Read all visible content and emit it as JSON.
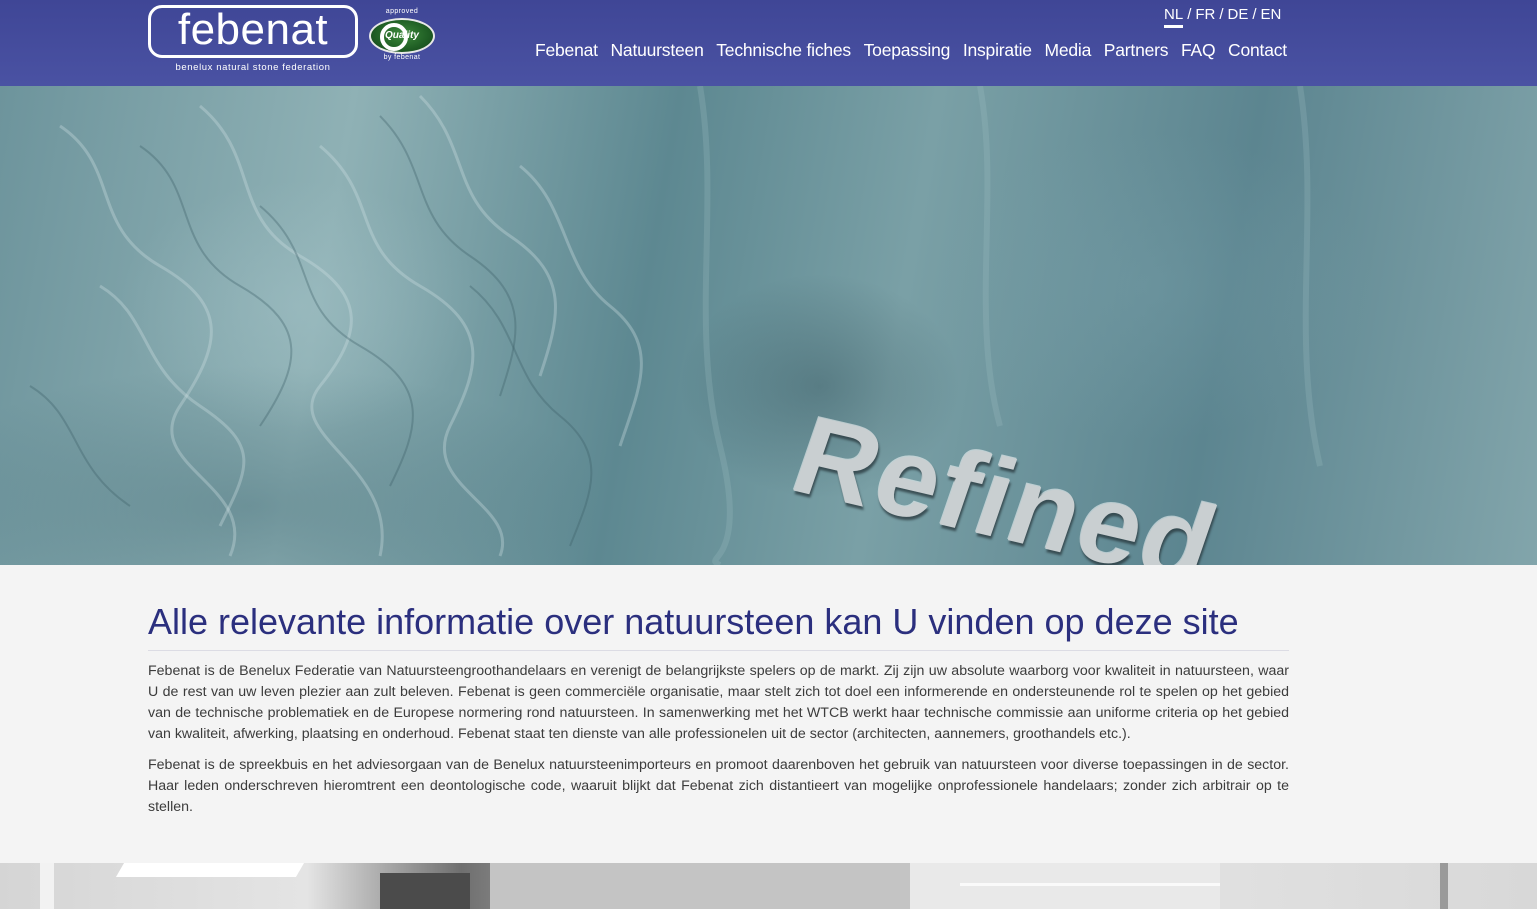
{
  "header": {
    "logo": {
      "word": "febenat",
      "tagline": "benelux natural stone federation"
    },
    "quality_badge": {
      "top": "approved",
      "word": "Quality",
      "bottom": "by febenat"
    },
    "languages": [
      {
        "label": "NL",
        "sep": "/"
      },
      {
        "label": "FR",
        "sep": "/"
      },
      {
        "label": "DE",
        "sep": "/"
      },
      {
        "label": "EN",
        "sep": ""
      }
    ],
    "active_language": "NL",
    "nav": [
      "Febenat",
      "Natuursteen",
      "Technische fiches",
      "Toepassing",
      "Inspiratie",
      "Media",
      "Partners",
      "FAQ",
      "Contact"
    ],
    "bg_color": "#4a52a3"
  },
  "hero": {
    "word": "Refined"
  },
  "main": {
    "title": "Alle relevante informatie over natuursteen kan U vinden op deze site",
    "paragraphs": [
      "Febenat is de Benelux Federatie van Natuursteengroothandelaars en verenigt de belangrijkste spelers op de markt. Zij zijn uw absolute waarborg voor kwaliteit in natuursteen, waar U de rest van uw leven plezier aan zult beleven. Febenat is geen commerciële organisatie, maar stelt zich tot doel een informerende en ondersteunende rol te spelen op het gebied van de technische problematiek en de Europese normering rond natuursteen. In samenwerking met het WTCB werkt haar technische commissie aan uniforme criteria op het gebied van kwaliteit, afwerking, plaatsing en onderhoud. Febenat staat ten dienste van alle professionelen uit de sector (architecten, aannemers, groothandels etc.).",
      "Febenat is de spreekbuis en het adviesorgaan van de Benelux natuursteenimporteurs en promoot daarenboven het gebruik van natuursteen voor diverse toepassingen in de sector. Haar leden onderschreven hieromtrent een deontologische code, waaruit blijkt dat Febenat zich distantieert van mogelijke onprofessionele handelaars; zonder zich arbitrair op te stellen."
    ],
    "title_color": "#2b2f7e"
  }
}
